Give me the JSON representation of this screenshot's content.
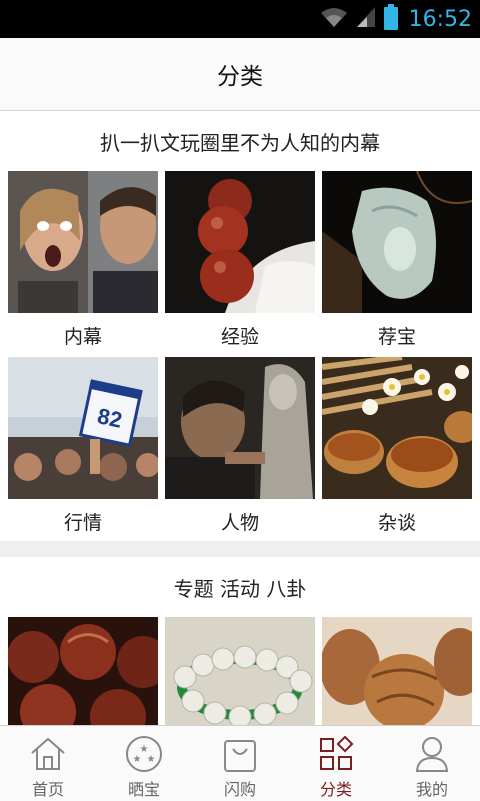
{
  "status_bar": {
    "time": "16:52",
    "icons": [
      "wifi-icon",
      "signal-icon",
      "battery-icon"
    ]
  },
  "header": {
    "title": "分类"
  },
  "section1": {
    "title": "扒一扒文玩圈里不为人知的内幕",
    "items": [
      {
        "label": "内幕",
        "image": "whisper-photo"
      },
      {
        "label": "经验",
        "image": "red-beads-photo"
      },
      {
        "label": "荐宝",
        "image": "jade-pendant-photo"
      },
      {
        "label": "行情",
        "image": "auction-paddle-photo"
      },
      {
        "label": "人物",
        "image": "craftsman-photo"
      },
      {
        "label": "杂谈",
        "image": "tea-cups-photo"
      }
    ]
  },
  "section2": {
    "title": "专题 活动 八卦",
    "items": [
      {
        "image": "walnut-beads-photo"
      },
      {
        "image": "bodhi-bracelet-photo"
      },
      {
        "image": "walnuts-photo"
      }
    ]
  },
  "tabbar": {
    "active": "分类",
    "active_color": "#7a1f1f",
    "items": [
      {
        "label": "首页",
        "icon": "home-icon"
      },
      {
        "label": "晒宝",
        "icon": "stars-icon"
      },
      {
        "label": "闪购",
        "icon": "shopping-bag-icon"
      },
      {
        "label": "分类",
        "icon": "category-grid-icon"
      },
      {
        "label": "我的",
        "icon": "user-icon"
      }
    ]
  }
}
